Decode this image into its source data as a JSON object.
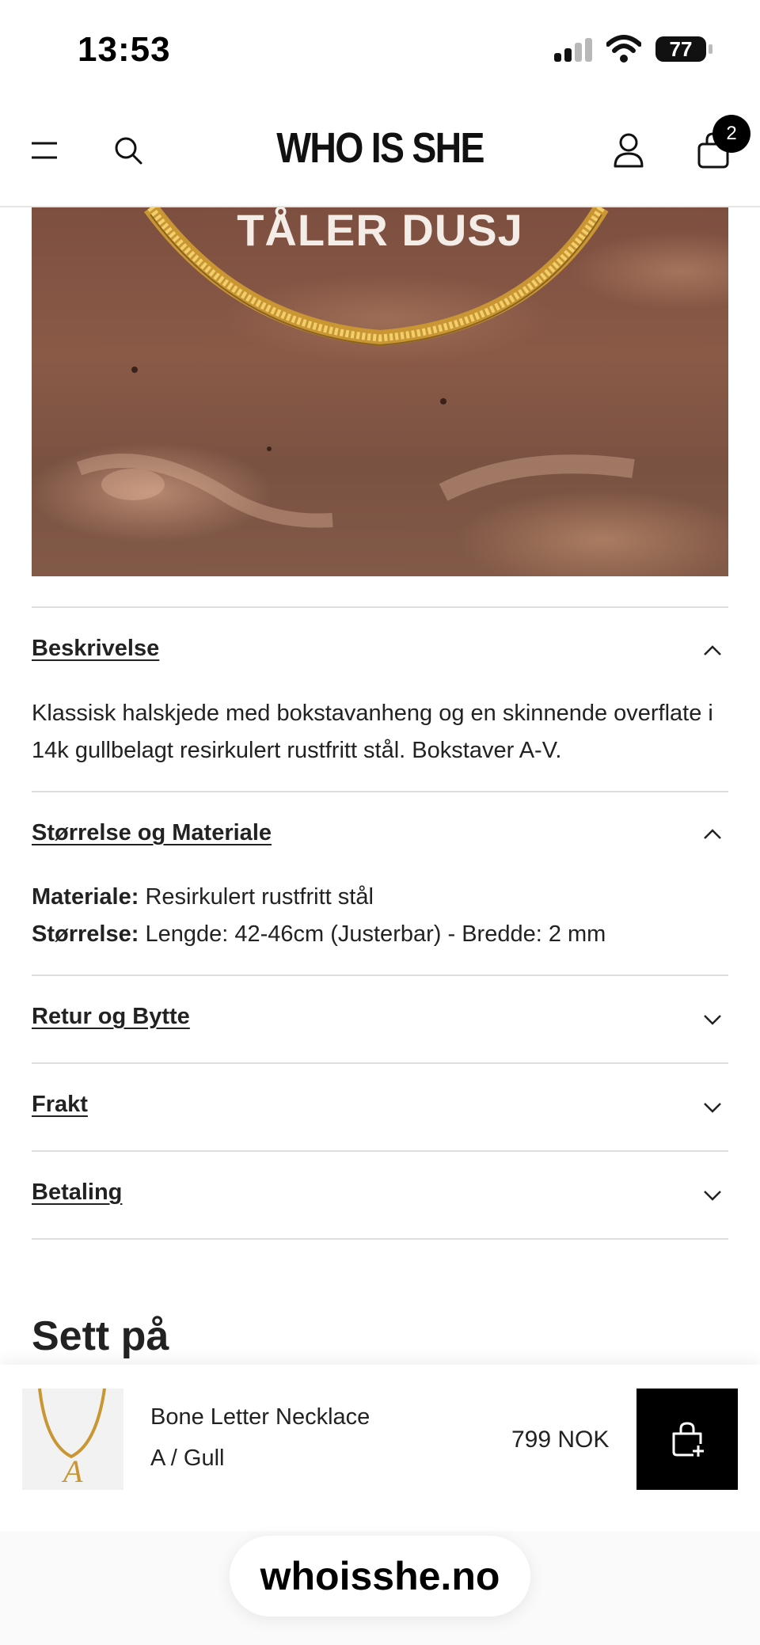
{
  "status_bar": {
    "time": "13:53",
    "battery": "77"
  },
  "header": {
    "logo": "WHO IS SHE",
    "cart_count": "2"
  },
  "hero": {
    "overlay_text": "TÅLER DUSJ"
  },
  "accordion": [
    {
      "title": "Beskrivelse",
      "expanded": true,
      "body": "Klassisk halskjede med bokstavanheng og en skinnende overflate i 14k gullbelagt resirkulert rustfritt stål. Bokstaver A-V."
    },
    {
      "title": "Størrelse og Materiale",
      "expanded": true,
      "lines": [
        {
          "label": "Materiale:",
          "value": " Resirkulert rustfritt stål"
        },
        {
          "label": "Størrelse:",
          "value": " Lengde: 42-46cm (Justerbar) - Bredde: 2 mm"
        }
      ]
    },
    {
      "title": "Retur og Bytte",
      "expanded": false
    },
    {
      "title": "Frakt",
      "expanded": false
    },
    {
      "title": "Betaling",
      "expanded": false
    }
  ],
  "section": {
    "title": "Sett på"
  },
  "sticky_bar": {
    "product_name": "Bone Letter Necklace",
    "variant": "A / Gull",
    "price": "799 NOK"
  },
  "browser": {
    "url": "whoisshe.no"
  },
  "icons": {
    "menu": "menu-icon",
    "search": "search-icon",
    "account": "user-icon",
    "cart": "bag-icon",
    "add_to_cart": "bag-plus-icon",
    "collapse": "chevron-up-icon",
    "expand": "chevron-down-icon"
  }
}
